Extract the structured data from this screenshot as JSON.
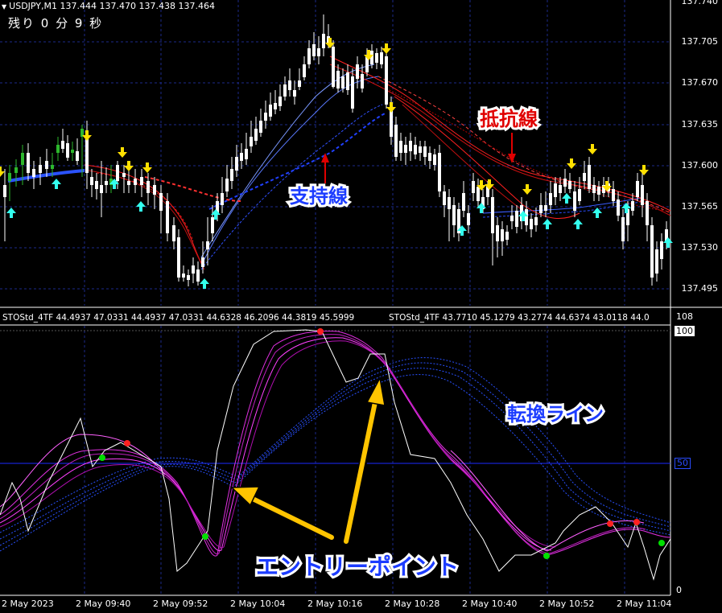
{
  "header": {
    "symbol_line": "USDJPY,M1  137.444 137.470 137.438 137.464",
    "countdown": "残り 0 分 9 秒"
  },
  "indicator": {
    "label_1": "STOStd_4TF 44.4937 47.0331 44.4937 47.0331 44.6328 46.2096 44.3819 45.5999",
    "label_2": "STOStd_4TF 43.7710 45.1279 43.2774 44.6374 43.0118 44.0",
    "scale_top": "108",
    "scale_100": "100",
    "scale_50": "50",
    "scale_0": "0"
  },
  "price_axis": [
    "137.740",
    "137.705",
    "137.670",
    "137.635",
    "137.600",
    "137.565",
    "137.530",
    "137.495"
  ],
  "time_axis": [
    "2 May 2023",
    "2 May 09:40",
    "2 May 09:52",
    "2 May 10:04",
    "2 May 10:16",
    "2 May 10:28",
    "2 May 10:40",
    "2 May 10:52",
    "2 May 11:04"
  ],
  "annotations": {
    "support": "支持線",
    "resistance": "抵抗線",
    "turn_line": "転換ライン",
    "entry_point": "エントリーポイント"
  },
  "colors": {
    "background": "#000000",
    "grid": "#1c2a8a",
    "bull_candle": "#2db82d",
    "bear_candle": "#ffffff",
    "down_arrow": "#ffe000",
    "up_arrow": "#33ffee",
    "ribbon_up": "#3a5cff",
    "ribbon_down": "#e01010",
    "stoch": "#e030e0",
    "annotation_arrow": "#ffc400"
  }
}
